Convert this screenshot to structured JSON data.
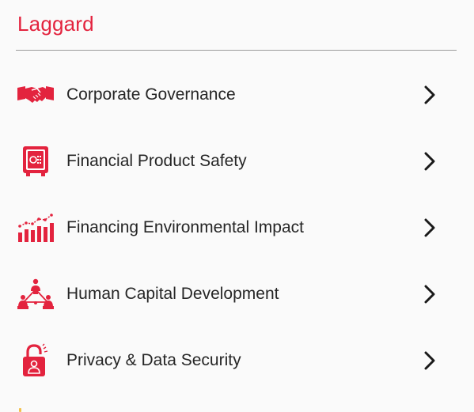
{
  "section": {
    "title": "Laggard",
    "items": [
      {
        "label": "Corporate Governance",
        "icon": "handshake-icon"
      },
      {
        "label": "Financial Product Safety",
        "icon": "safe-icon"
      },
      {
        "label": "Financing Environmental Impact",
        "icon": "bar-chart-trend-icon"
      },
      {
        "label": "Human Capital Development",
        "icon": "people-network-icon"
      },
      {
        "label": "Privacy & Data Security",
        "icon": "padlock-user-icon"
      }
    ]
  },
  "colors": {
    "accent": "#e3233e",
    "text": "#262626",
    "chevron": "#1a1a1a",
    "divider": "#9a9a9a",
    "background": "#fafafa"
  }
}
